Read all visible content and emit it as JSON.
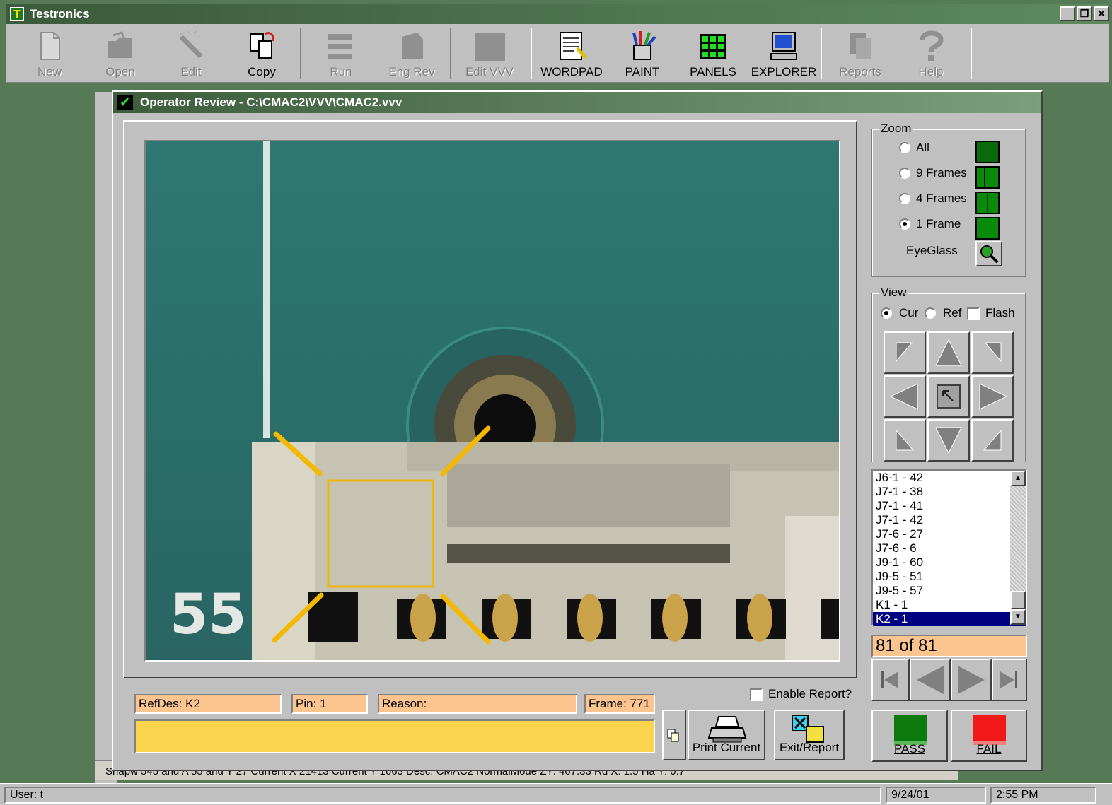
{
  "app": {
    "title": "Testronics",
    "logo": "T"
  },
  "window_controls": {
    "minimize": "_",
    "maximize": "❒",
    "close": "✕"
  },
  "toolbar": {
    "items": [
      {
        "label": "New",
        "icon": "new-file-icon",
        "enabled": false
      },
      {
        "label": "Open",
        "icon": "open-folder-icon",
        "enabled": false
      },
      {
        "label": "Edit",
        "icon": "edit-wand-icon",
        "enabled": false
      },
      {
        "label": "Copy",
        "icon": "copy-icon",
        "enabled": true
      },
      {
        "label": "Run",
        "icon": "run-icon",
        "enabled": false
      },
      {
        "label": "Eng Rev",
        "icon": "eng-rev-icon",
        "enabled": false
      },
      {
        "label": "Edit VVV",
        "icon": "edit-vvv-icon",
        "enabled": false
      },
      {
        "label": "WORDPAD",
        "icon": "wordpad-icon",
        "enabled": true
      },
      {
        "label": "PAINT",
        "icon": "paint-icon",
        "enabled": true
      },
      {
        "label": "PANELS",
        "icon": "panels-icon",
        "enabled": true
      },
      {
        "label": "EXPLORER",
        "icon": "explorer-icon",
        "enabled": true
      },
      {
        "label": "Reports",
        "icon": "reports-icon",
        "enabled": false
      },
      {
        "label": "Help",
        "icon": "help-icon",
        "enabled": false
      }
    ]
  },
  "dialog": {
    "title": "Operator Review - C:\\CMAC2\\VVV\\CMAC2.vvv",
    "photo_label": "55",
    "zoom": {
      "label": "Zoom",
      "options": [
        {
          "label": "All",
          "selected": false
        },
        {
          "label": "9 Frames",
          "selected": false
        },
        {
          "label": "4 Frames",
          "selected": false
        },
        {
          "label": "1 Frame",
          "selected": true
        }
      ],
      "eyeglass_label": "EyeGlass"
    },
    "view": {
      "label": "View",
      "cur_label": "Cur",
      "ref_label": "Ref",
      "flash_label": "Flash",
      "selected": "Cur",
      "flash_checked": false
    },
    "list": {
      "items": [
        "J6-1 - 42",
        "J7-1 - 38",
        "J7-1 - 41",
        "J7-1 - 42",
        "J7-6 - 27",
        "J7-6 - 6",
        "J9-1 - 60",
        "J9-5 - 51",
        "J9-5 - 57",
        "K1 - 1",
        "K2 - 1"
      ],
      "selected_index": 10
    },
    "counter": "81 of 81",
    "fields": {
      "refdes": "RefDes: K2",
      "pin": "Pin: 1",
      "reason": "Reason:",
      "frame": "Frame: 771"
    },
    "enable_report": {
      "label": "Enable Report?",
      "checked": false
    },
    "buttons": {
      "print_current": "Print Current",
      "exit_report": "Exit/Report",
      "pass": "PASS",
      "fail": "FAIL"
    },
    "colors": {
      "pass": "#0c7a0c",
      "fail": "#f01818",
      "field": "#fcc590",
      "notes": "#fcd54e"
    }
  },
  "background_window": {
    "status_text": "Snapw 545   and A 55     and Y 27      Current X 21413    Current Y 1663      Desc: CMAC2                         NormalMode     ZY: 467.33  Rd X: 1.5  Ha Y: 0.7"
  },
  "statusbar": {
    "user": "User: t",
    "date": "9/24/01",
    "time": "2:55 PM"
  }
}
